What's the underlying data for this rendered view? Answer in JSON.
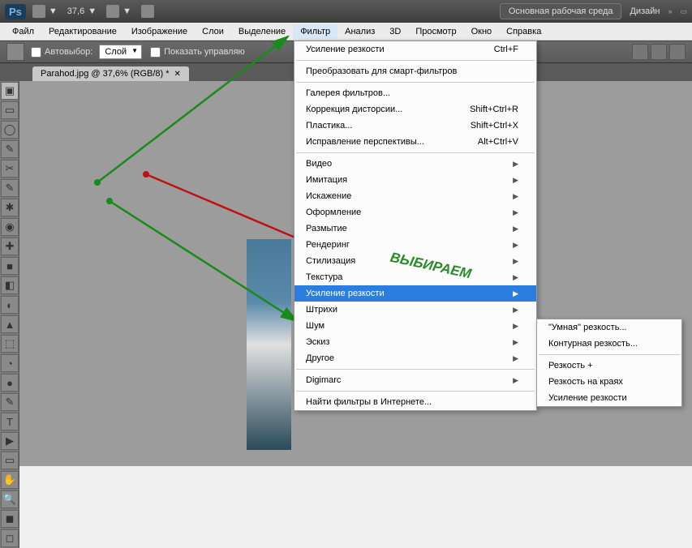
{
  "header": {
    "logo": "Ps",
    "zoom": "37,6",
    "workspace_btn": "Основная рабочая среда",
    "design_label": "Дизайн"
  },
  "menubar": {
    "items": [
      "Файл",
      "Редактирование",
      "Изображение",
      "Слои",
      "Выделение",
      "Фильтр",
      "Анализ",
      "3D",
      "Просмотр",
      "Окно",
      "Справка"
    ]
  },
  "options": {
    "autoselect": "Автовыбор:",
    "layer_dropdown": "Слой",
    "show_controls": "Показать управляю"
  },
  "doc_tab": {
    "title": "Parahod.jpg @ 37,6% (RGB/8) *"
  },
  "filter_menu": {
    "items": [
      {
        "label": "Усиление резкости",
        "shortcut": "Ctrl+F"
      },
      {
        "sep": true
      },
      {
        "label": "Преобразовать для смарт-фильтров"
      },
      {
        "sep": true
      },
      {
        "label": "Галерея фильтров..."
      },
      {
        "label": "Коррекция дисторсии...",
        "shortcut": "Shift+Ctrl+R"
      },
      {
        "label": "Пластика...",
        "shortcut": "Shift+Ctrl+X"
      },
      {
        "label": "Исправление перспективы...",
        "shortcut": "Alt+Ctrl+V"
      },
      {
        "sep": true
      },
      {
        "label": "Видео",
        "submenu": true
      },
      {
        "label": "Имитация",
        "submenu": true
      },
      {
        "label": "Искажение",
        "submenu": true
      },
      {
        "label": "Оформление",
        "submenu": true
      },
      {
        "label": "Размытие",
        "submenu": true
      },
      {
        "label": "Рендеринг",
        "submenu": true
      },
      {
        "label": "Стилизация",
        "submenu": true
      },
      {
        "label": "Текстура",
        "submenu": true
      },
      {
        "label": "Усиление резкости",
        "submenu": true,
        "highlighted": true
      },
      {
        "label": "Штрихи",
        "submenu": true
      },
      {
        "label": "Шум",
        "submenu": true
      },
      {
        "label": "Эскиз",
        "submenu": true
      },
      {
        "label": "Другое",
        "submenu": true
      },
      {
        "sep": true
      },
      {
        "label": "Digimarc",
        "submenu": true
      },
      {
        "sep": true
      },
      {
        "label": "Найти фильтры в Интернете..."
      }
    ]
  },
  "submenu": {
    "items": [
      "\"Умная\" резкость...",
      "Контурная резкость...",
      "__sep__",
      "Резкость +",
      "Резкость на краях",
      "Усиление резкости"
    ]
  },
  "annotation": "ВЫБИРАЕМ",
  "tools": [
    "▣",
    "▭",
    "◯",
    "✎",
    "✂",
    "✎",
    "✱",
    "◉",
    "✚",
    "■",
    "◧",
    "◐",
    "▲",
    "⬚",
    "◔",
    "●",
    "✎",
    "T",
    "▶",
    "▭",
    "✋",
    "🔍",
    "◼",
    "◻"
  ]
}
